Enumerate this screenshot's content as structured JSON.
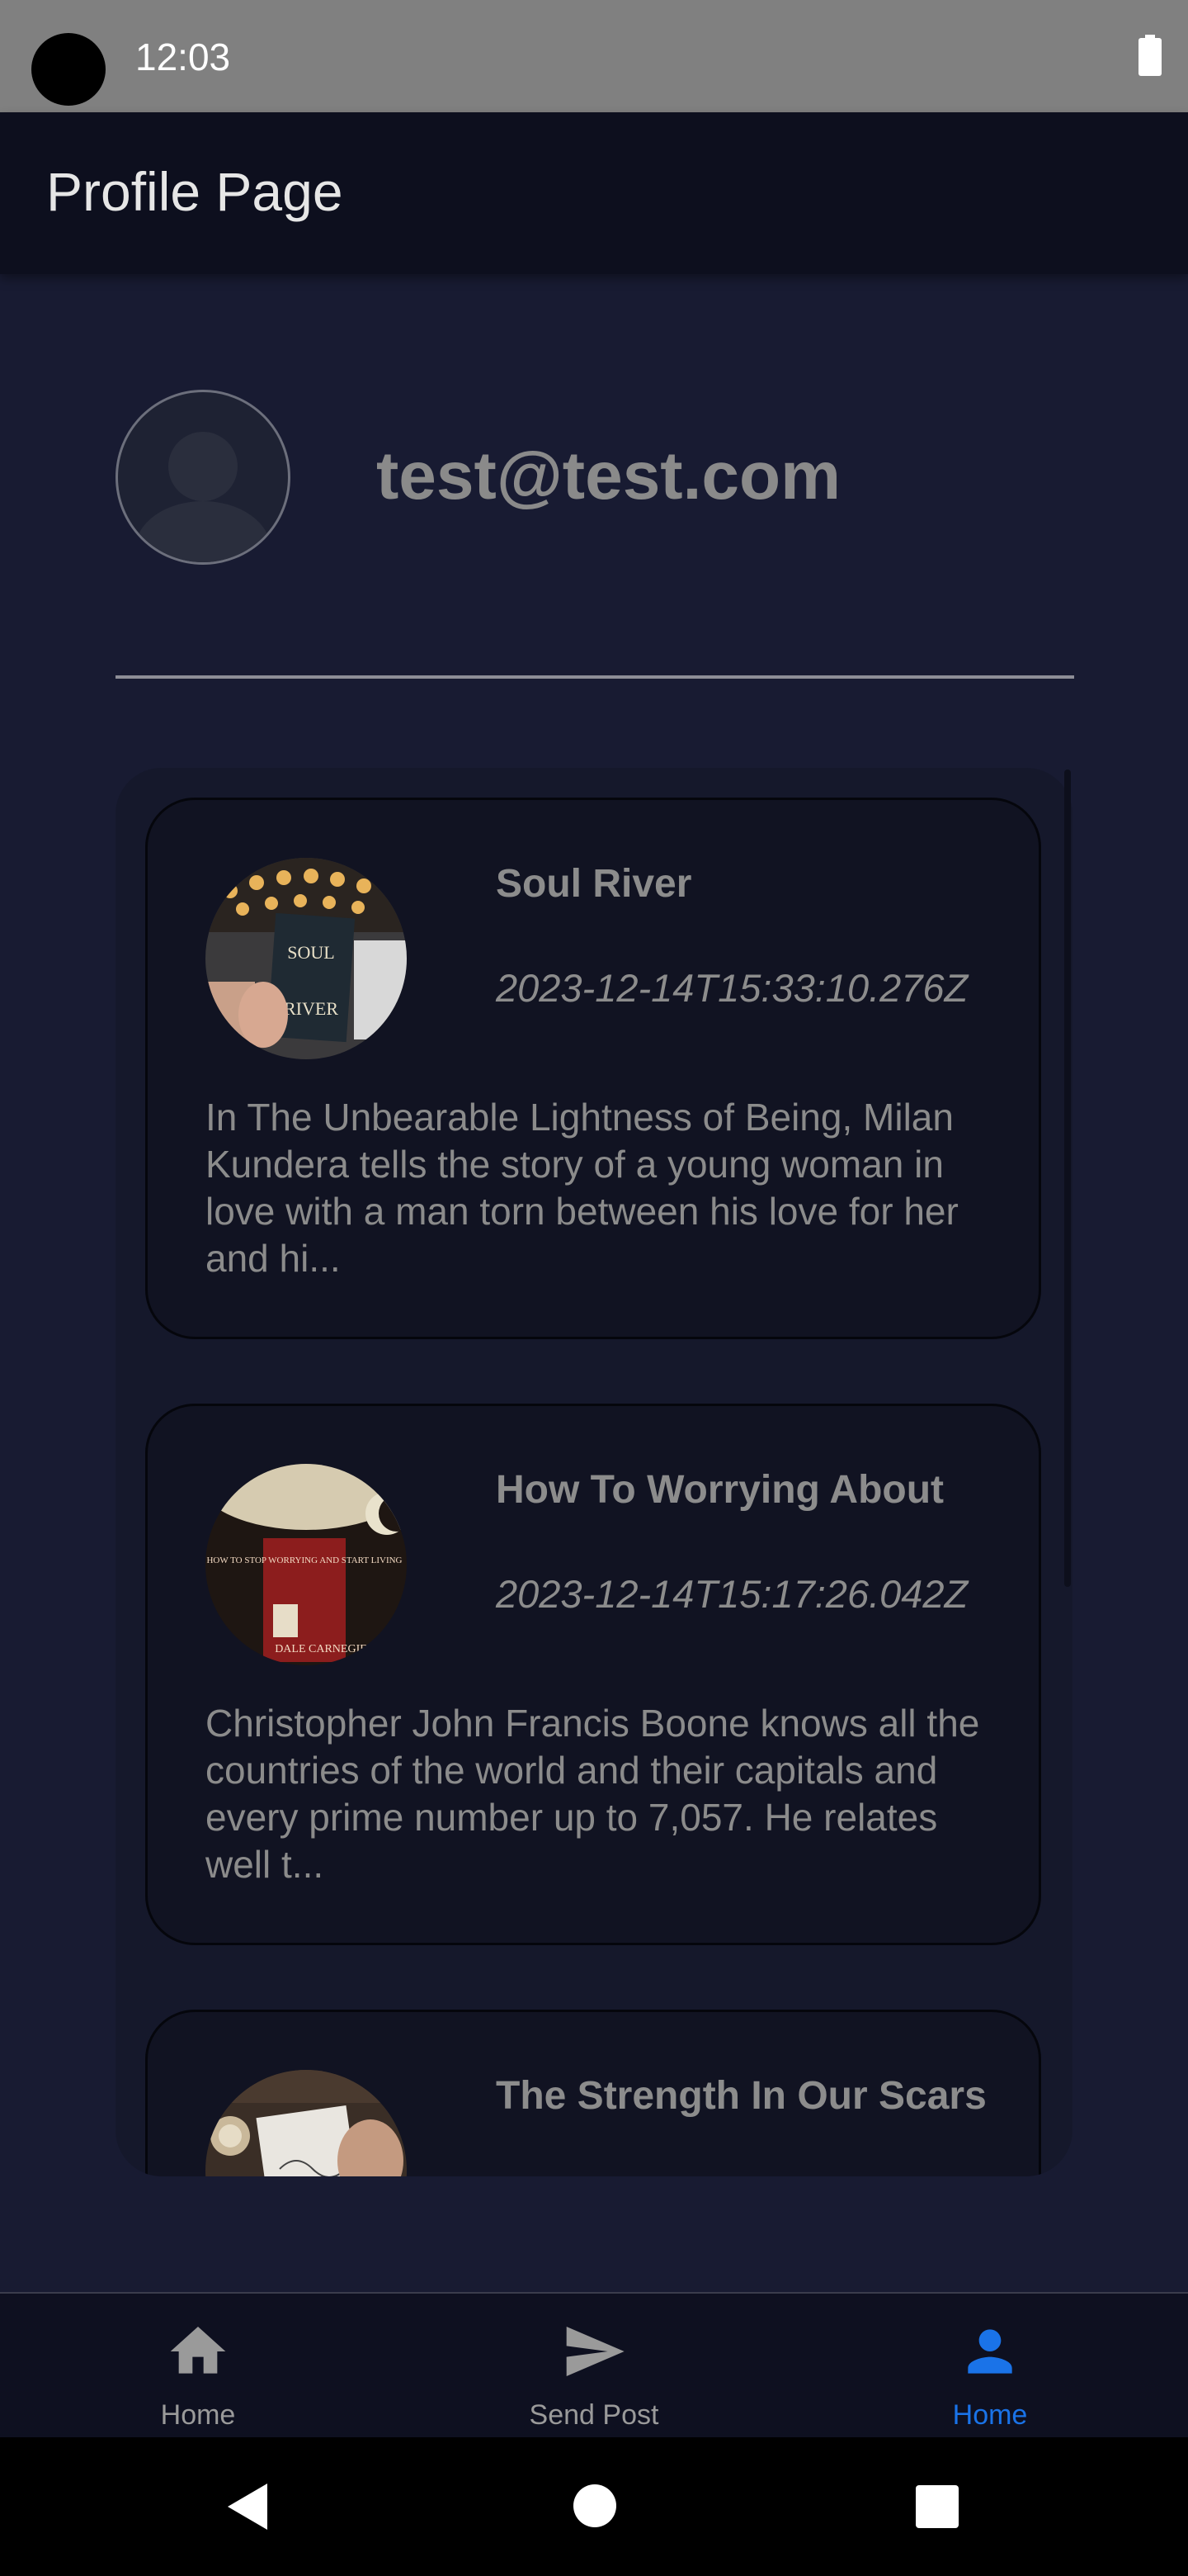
{
  "status_bar": {
    "time": "12:03"
  },
  "app_bar": {
    "title": "Profile Page"
  },
  "profile": {
    "email": "test@test.com",
    "avatar_icon": "person-avatar-icon"
  },
  "posts": [
    {
      "title": "Soul River",
      "date": "2023-12-14T15:33:10.276Z",
      "excerpt": "In The Unbearable Lightness of Being, Milan Kundera tells the story of a young woman in love with a man torn between his love for her and hi...",
      "cover_text_top": "SOUL",
      "cover_text_bottom": "RIVER"
    },
    {
      "title": "How To Worrying About",
      "date": "2023-12-14T15:17:26.042Z",
      "excerpt": "Christopher John Francis Boone knows all the countries of the world and their capitals and every prime number up to 7,057. He relates well t...",
      "cover_text_top": "HOW TO STOP WORRYING AND START LIVING",
      "cover_text_bottom": "DALE CARNEGIE"
    },
    {
      "title": "The Strength In Our Scars"
    }
  ],
  "bottom_nav": {
    "items": [
      {
        "label": "Home",
        "icon": "home-icon",
        "active": false
      },
      {
        "label": "Send Post",
        "icon": "send-icon",
        "active": false
      },
      {
        "label": "Home",
        "icon": "person-icon",
        "active": true
      }
    ],
    "active_color": "#1a73e8",
    "inactive_color": "#9a9a9a"
  }
}
